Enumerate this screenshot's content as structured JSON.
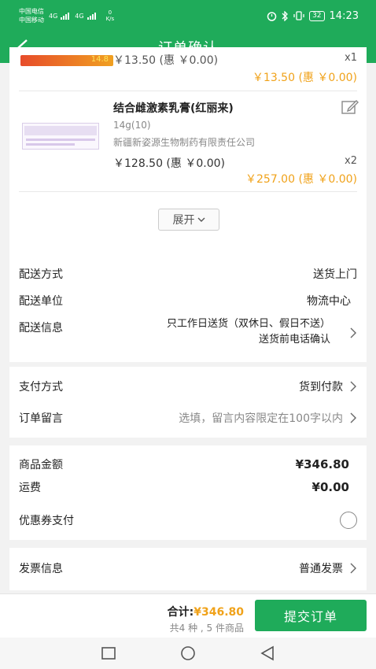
{
  "status_bar": {
    "carrier1": "中国电信",
    "carrier2": "中国移动",
    "net1": "4G",
    "net2": "4G",
    "speed": "0",
    "speed_unit": "K/s",
    "battery": "32",
    "time": "14:23"
  },
  "nav": {
    "title": "订单确认"
  },
  "products": [
    {
      "badge": "14.8",
      "price_line": "￥13.50 (惠 ￥0.00)",
      "qty": "x1",
      "total_line": "￥13.50 (惠 ￥0.00)"
    },
    {
      "name": "结合雌激素乳膏(红丽来)",
      "spec": "14g(10)",
      "manufacturer": "新疆新姿源生物制药有限责任公司",
      "price_line": "￥128.50 (惠 ￥0.00)",
      "qty": "x2",
      "total_line": "￥257.00 (惠 ￥0.00)"
    }
  ],
  "expand_label": "展开",
  "delivery": {
    "method_label": "配送方式",
    "method_value": "送货上门",
    "unit_label": "配送单位",
    "unit_value": "物流中心",
    "info_label": "配送信息",
    "info_line1": "只工作日送货（双休日、假日不送）",
    "info_line2": "送货前电话确认"
  },
  "payment": {
    "method_label": "支付方式",
    "method_value": "货到付款",
    "note_label": "订单留言",
    "note_placeholder": "选填，留言内容限定在100字以内"
  },
  "amounts": {
    "goods_label": "商品金额",
    "goods_value": "¥346.80",
    "shipping_label": "运费",
    "shipping_value": "¥0.00",
    "coupon_label": "优惠券支付"
  },
  "invoice": {
    "label": "发票信息",
    "value": "普通发票"
  },
  "footer": {
    "total_prefix": "合计:",
    "total_amount": "¥346.80",
    "count_text": "共4 种 , 5 件商品",
    "submit_label": "提交订单"
  },
  "colors": {
    "accent": "#1fab5a",
    "price": "#f0a21a"
  }
}
